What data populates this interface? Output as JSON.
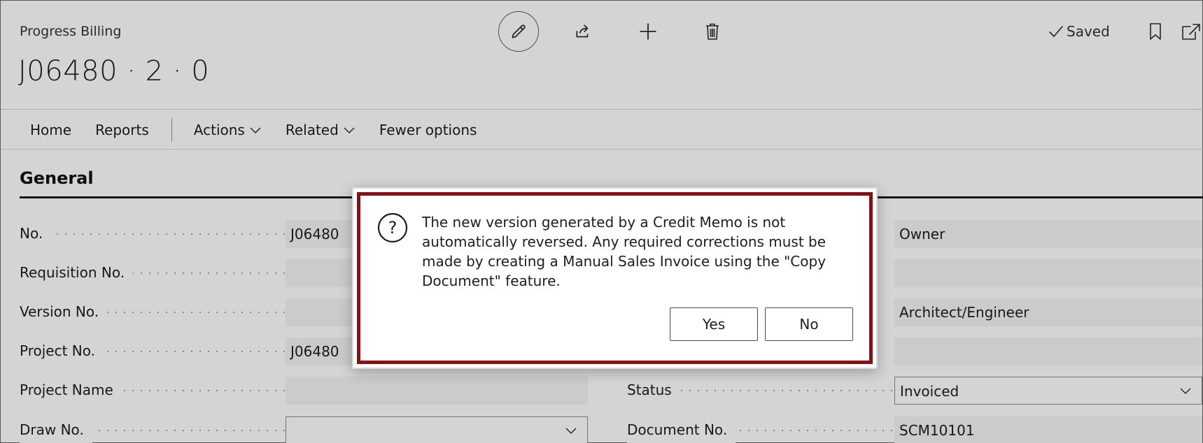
{
  "header": {
    "caption": "Progress Billing",
    "title": "J06480 · 2 · 0",
    "saved_label": "Saved"
  },
  "nav": {
    "home": "Home",
    "reports": "Reports",
    "actions": "Actions",
    "related": "Related",
    "fewer": "Fewer options"
  },
  "section": {
    "title": "General"
  },
  "left_fields": [
    {
      "label": "No.",
      "value": "J06480",
      "type": "text"
    },
    {
      "label": "Requisition No.",
      "value": "",
      "type": "text"
    },
    {
      "label": "Version No.",
      "value": "",
      "type": "text"
    },
    {
      "label": "Project No.",
      "value": "J06480",
      "type": "text"
    },
    {
      "label": "Project Name",
      "value": "",
      "type": "text"
    },
    {
      "label": "Draw No.",
      "value": "",
      "type": "select"
    }
  ],
  "right_fields": [
    {
      "label": "",
      "value": "Owner",
      "type": "text"
    },
    {
      "label": "",
      "value": "",
      "type": "text"
    },
    {
      "label": "",
      "value": "Architect/Engineer",
      "type": "text"
    },
    {
      "label": "",
      "value": "",
      "type": "text"
    },
    {
      "label": "Status",
      "value": "Invoiced",
      "type": "select"
    },
    {
      "label": "Document No.",
      "value": "SCM10101",
      "type": "text"
    }
  ],
  "dialog": {
    "message": "The new version generated by a Credit Memo is not automatically reversed. Any required corrections must be made by creating a Manual Sales Invoice using the \"Copy Document\" feature.",
    "yes": "Yes",
    "no": "No"
  },
  "colors": {
    "dialog_border": "#8b0e15",
    "edit_ring": "#3d6f6b"
  }
}
